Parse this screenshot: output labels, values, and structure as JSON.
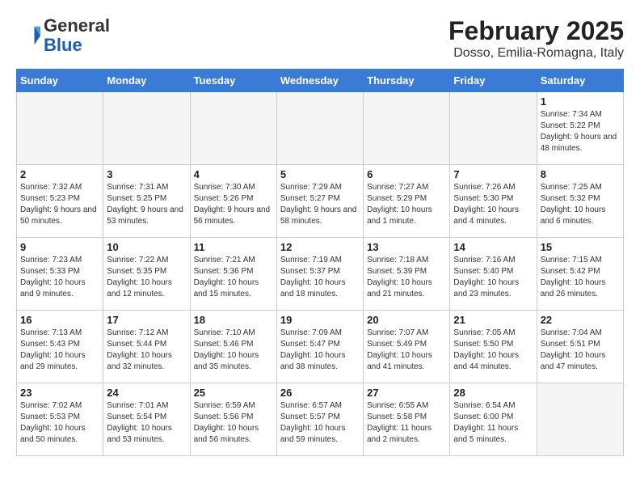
{
  "header": {
    "logo_general": "General",
    "logo_blue": "Blue",
    "month_title": "February 2025",
    "location": "Dosso, Emilia-Romagna, Italy"
  },
  "days_of_week": [
    "Sunday",
    "Monday",
    "Tuesday",
    "Wednesday",
    "Thursday",
    "Friday",
    "Saturday"
  ],
  "weeks": [
    [
      {
        "num": "",
        "info": "",
        "empty": true
      },
      {
        "num": "",
        "info": "",
        "empty": true
      },
      {
        "num": "",
        "info": "",
        "empty": true
      },
      {
        "num": "",
        "info": "",
        "empty": true
      },
      {
        "num": "",
        "info": "",
        "empty": true
      },
      {
        "num": "",
        "info": "",
        "empty": true
      },
      {
        "num": "1",
        "info": "Sunrise: 7:34 AM\nSunset: 5:22 PM\nDaylight: 9 hours and 48 minutes.",
        "empty": false
      }
    ],
    [
      {
        "num": "2",
        "info": "Sunrise: 7:32 AM\nSunset: 5:23 PM\nDaylight: 9 hours and 50 minutes.",
        "empty": false
      },
      {
        "num": "3",
        "info": "Sunrise: 7:31 AM\nSunset: 5:25 PM\nDaylight: 9 hours and 53 minutes.",
        "empty": false
      },
      {
        "num": "4",
        "info": "Sunrise: 7:30 AM\nSunset: 5:26 PM\nDaylight: 9 hours and 56 minutes.",
        "empty": false
      },
      {
        "num": "5",
        "info": "Sunrise: 7:29 AM\nSunset: 5:27 PM\nDaylight: 9 hours and 58 minutes.",
        "empty": false
      },
      {
        "num": "6",
        "info": "Sunrise: 7:27 AM\nSunset: 5:29 PM\nDaylight: 10 hours and 1 minute.",
        "empty": false
      },
      {
        "num": "7",
        "info": "Sunrise: 7:26 AM\nSunset: 5:30 PM\nDaylight: 10 hours and 4 minutes.",
        "empty": false
      },
      {
        "num": "8",
        "info": "Sunrise: 7:25 AM\nSunset: 5:32 PM\nDaylight: 10 hours and 6 minutes.",
        "empty": false
      }
    ],
    [
      {
        "num": "9",
        "info": "Sunrise: 7:23 AM\nSunset: 5:33 PM\nDaylight: 10 hours and 9 minutes.",
        "empty": false
      },
      {
        "num": "10",
        "info": "Sunrise: 7:22 AM\nSunset: 5:35 PM\nDaylight: 10 hours and 12 minutes.",
        "empty": false
      },
      {
        "num": "11",
        "info": "Sunrise: 7:21 AM\nSunset: 5:36 PM\nDaylight: 10 hours and 15 minutes.",
        "empty": false
      },
      {
        "num": "12",
        "info": "Sunrise: 7:19 AM\nSunset: 5:37 PM\nDaylight: 10 hours and 18 minutes.",
        "empty": false
      },
      {
        "num": "13",
        "info": "Sunrise: 7:18 AM\nSunset: 5:39 PM\nDaylight: 10 hours and 21 minutes.",
        "empty": false
      },
      {
        "num": "14",
        "info": "Sunrise: 7:16 AM\nSunset: 5:40 PM\nDaylight: 10 hours and 23 minutes.",
        "empty": false
      },
      {
        "num": "15",
        "info": "Sunrise: 7:15 AM\nSunset: 5:42 PM\nDaylight: 10 hours and 26 minutes.",
        "empty": false
      }
    ],
    [
      {
        "num": "16",
        "info": "Sunrise: 7:13 AM\nSunset: 5:43 PM\nDaylight: 10 hours and 29 minutes.",
        "empty": false
      },
      {
        "num": "17",
        "info": "Sunrise: 7:12 AM\nSunset: 5:44 PM\nDaylight: 10 hours and 32 minutes.",
        "empty": false
      },
      {
        "num": "18",
        "info": "Sunrise: 7:10 AM\nSunset: 5:46 PM\nDaylight: 10 hours and 35 minutes.",
        "empty": false
      },
      {
        "num": "19",
        "info": "Sunrise: 7:09 AM\nSunset: 5:47 PM\nDaylight: 10 hours and 38 minutes.",
        "empty": false
      },
      {
        "num": "20",
        "info": "Sunrise: 7:07 AM\nSunset: 5:49 PM\nDaylight: 10 hours and 41 minutes.",
        "empty": false
      },
      {
        "num": "21",
        "info": "Sunrise: 7:05 AM\nSunset: 5:50 PM\nDaylight: 10 hours and 44 minutes.",
        "empty": false
      },
      {
        "num": "22",
        "info": "Sunrise: 7:04 AM\nSunset: 5:51 PM\nDaylight: 10 hours and 47 minutes.",
        "empty": false
      }
    ],
    [
      {
        "num": "23",
        "info": "Sunrise: 7:02 AM\nSunset: 5:53 PM\nDaylight: 10 hours and 50 minutes.",
        "empty": false
      },
      {
        "num": "24",
        "info": "Sunrise: 7:01 AM\nSunset: 5:54 PM\nDaylight: 10 hours and 53 minutes.",
        "empty": false
      },
      {
        "num": "25",
        "info": "Sunrise: 6:59 AM\nSunset: 5:56 PM\nDaylight: 10 hours and 56 minutes.",
        "empty": false
      },
      {
        "num": "26",
        "info": "Sunrise: 6:57 AM\nSunset: 5:57 PM\nDaylight: 10 hours and 59 minutes.",
        "empty": false
      },
      {
        "num": "27",
        "info": "Sunrise: 6:55 AM\nSunset: 5:58 PM\nDaylight: 11 hours and 2 minutes.",
        "empty": false
      },
      {
        "num": "28",
        "info": "Sunrise: 6:54 AM\nSunset: 6:00 PM\nDaylight: 11 hours and 5 minutes.",
        "empty": false
      },
      {
        "num": "",
        "info": "",
        "empty": true
      }
    ]
  ]
}
